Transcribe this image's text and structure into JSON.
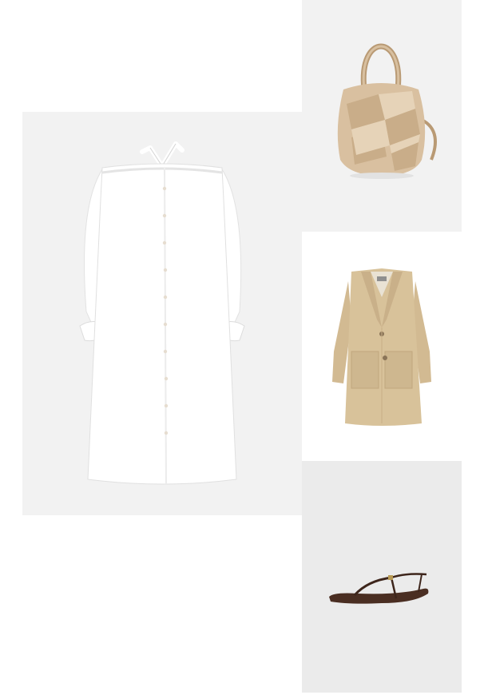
{
  "board": {
    "items": [
      {
        "name": "off-shoulder-shirt-dress",
        "kind": "dress",
        "background": "#f2f2f2",
        "color": "#ffffff"
      },
      {
        "name": "woven-leather-hobo-bag",
        "kind": "bag",
        "background": "#f2f2f2",
        "color": "#d9c0a0"
      },
      {
        "name": "beige-trench-coat",
        "kind": "coat",
        "background": "#ffffff",
        "color": "#d8c29a"
      },
      {
        "name": "thong-strap-sandal",
        "kind": "sandal",
        "background": "#ebebeb",
        "color": "#4a2e22"
      }
    ]
  },
  "icons": [
    "dress-image",
    "bag-image",
    "coat-image",
    "sandal-image"
  ]
}
